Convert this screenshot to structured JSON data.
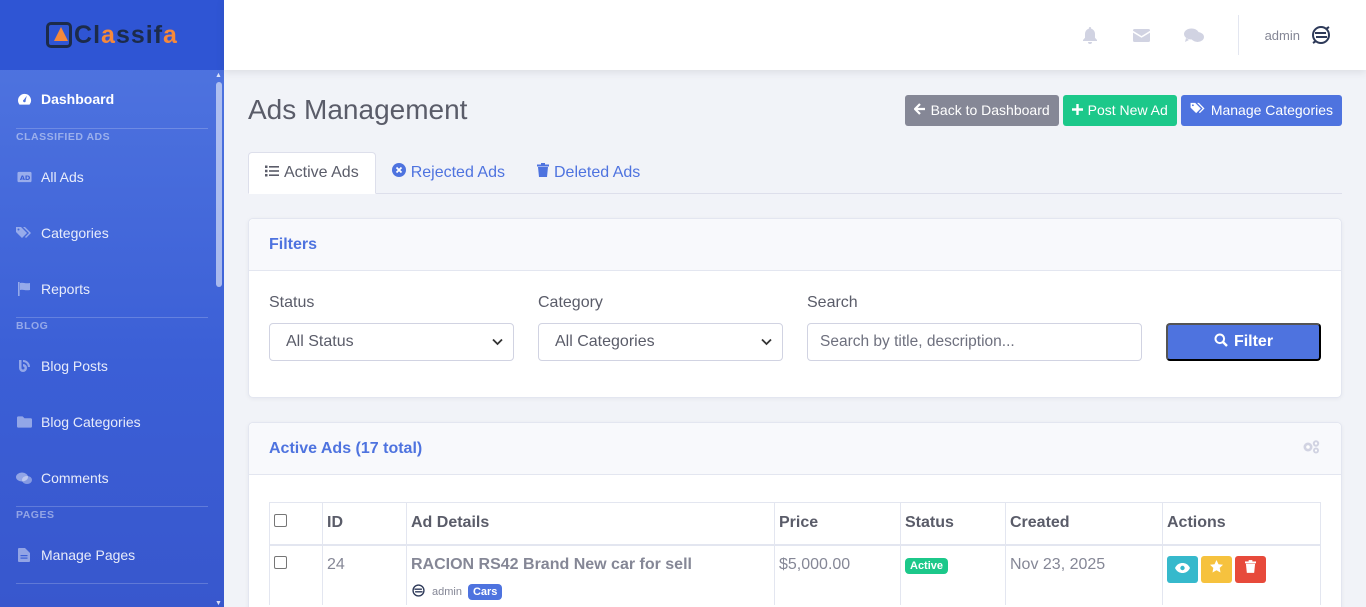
{
  "brand": {
    "name_prefix": "Cl",
    "name_accent": "a",
    "name_rest": "ssif",
    "name_accent2": "a"
  },
  "sidebar": {
    "dashboard": "Dashboard",
    "section_classified": "CLASSIFIED ADS",
    "all_ads": "All Ads",
    "categories": "Categories",
    "reports": "Reports",
    "section_blog": "BLOG",
    "blog_posts": "Blog Posts",
    "blog_categories": "Blog Categories",
    "comments": "Comments",
    "section_pages": "PAGES",
    "manage_pages": "Manage Pages"
  },
  "topbar": {
    "user_name": "admin"
  },
  "page": {
    "title": "Ads Management",
    "back_button": "Back to Dashboard",
    "post_button": "Post New Ad",
    "manage_categories_button": "Manage Categories"
  },
  "tabs": {
    "active": "Active Ads",
    "rejected": "Rejected Ads",
    "deleted": "Deleted Ads"
  },
  "filters": {
    "title": "Filters",
    "status_label": "Status",
    "status_value": "All Status",
    "category_label": "Category",
    "category_value": "All Categories",
    "search_label": "Search",
    "search_placeholder": "Search by title, description...",
    "filter_button": "Filter"
  },
  "ads_table": {
    "title": "Active Ads (17 total)",
    "headers": {
      "id": "ID",
      "details": "Ad Details",
      "price": "Price",
      "status": "Status",
      "created": "Created",
      "actions": "Actions"
    },
    "rows": [
      {
        "id": "24",
        "title": "RACION RS42 Brand New car for sell",
        "author": "admin",
        "category": "Cars",
        "price": "$5,000.00",
        "status": "Active",
        "created": "Nov 23, 2025"
      }
    ]
  },
  "colors": {
    "primary": "#4e73df",
    "success": "#1cc88a",
    "secondary": "#858796",
    "info": "#36b9cc",
    "warning": "#f6c23e",
    "danger": "#e74a3b",
    "brand_orange": "#f6893b"
  }
}
